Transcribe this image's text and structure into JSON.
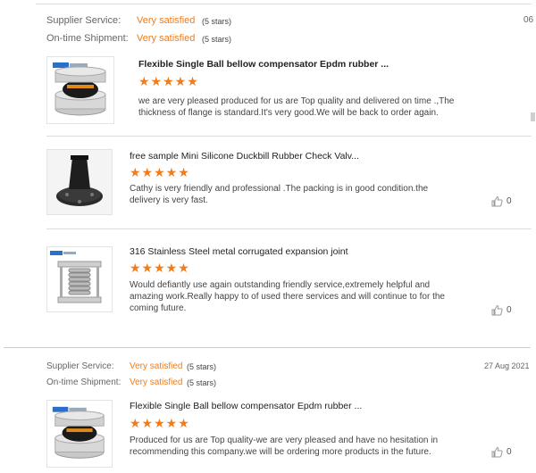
{
  "reviews": [
    {
      "supplier_label": "Supplier Service:",
      "supplier_value": "Very satisfied",
      "supplier_stars": "(5 stars)",
      "shipment_label": "On-time Shipment:",
      "shipment_value": "Very satisfied",
      "shipment_stars": "(5 stars)",
      "date": "06",
      "products": [
        {
          "title": "Flexible Single Ball bellow compensator Epdm rubber ...",
          "stars": "★★★★★",
          "rating": 5,
          "text": "we are very pleased produced for us are Top quality and delivered on time  .,The thickness of flange is standard.It's very good.We will be back to order again.",
          "likes": ""
        },
        {
          "title": "free sample Mini Silicone Duckbill Rubber Check Valv...",
          "stars": "★★★★★",
          "rating": 5,
          "text": "Cathy is very friendly and professional .The packing is in good condition.the delivery is very fast.",
          "likes": "0"
        },
        {
          "title": "316 Stainless Steel metal corrugated expansion joint",
          "stars": "★★★★★",
          "rating": 5,
          "text": "Would defiantly use again outstanding friendly service,extremely helpful and amazing work.Really happy to of used there services and will continue to for the coming future.",
          "likes": "0"
        }
      ]
    },
    {
      "supplier_label": "Supplier Service:",
      "supplier_value": "Very satisfied",
      "supplier_stars": "(5 stars)",
      "shipment_label": "On-time Shipment:",
      "shipment_value": "Very satisfied",
      "shipment_stars": "(5 stars)",
      "date": "27 Aug 2021",
      "products": [
        {
          "title": "Flexible Single Ball bellow compensator Epdm rubber ...",
          "stars": "★★★★★",
          "rating": 5,
          "text": "Produced for us are Top quality-we are very pleased and have no hesitation in recommending this company.we will be ordering more products in the future.",
          "likes": "0"
        }
      ]
    }
  ],
  "colors": {
    "accent": "#f07c1b",
    "separator": "#dcdcdc"
  }
}
